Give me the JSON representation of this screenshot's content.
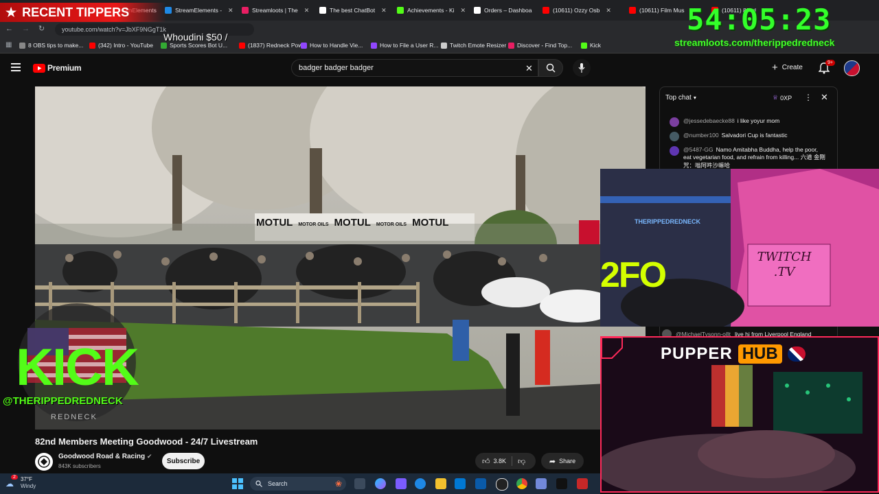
{
  "browser": {
    "tabs": [
      {
        "title": "StreamElements",
        "color": "#444"
      },
      {
        "title": "StreamElements -",
        "color": "#1e88e5"
      },
      {
        "title": "Streamloots | The",
        "color": "#e91e63"
      },
      {
        "title": "The best ChatBot",
        "color": "#fff"
      },
      {
        "title": "Achievements - Ki",
        "color": "#53fc18"
      },
      {
        "title": "Orders – Dashboa",
        "color": "#fff"
      },
      {
        "title": "(10611) Ozzy Osb",
        "color": "#ff0000"
      },
      {
        "title": "(10611) Film Mus",
        "color": "#ff0000"
      },
      {
        "title": "(10611) 82nd",
        "color": "#ff0000"
      }
    ],
    "url": "youtube.com/watch?v=JbXF9NGgT1k",
    "bookmarks": [
      {
        "label": "8 OBS tips to make...",
        "color": "#888"
      },
      {
        "label": "(342) Intro - YouTube",
        "color": "#ff0000"
      },
      {
        "label": "Sports Scores Bot U...",
        "color": "#3a3"
      },
      {
        "label": "(1837) Redneck Pow...",
        "color": "#ff0000"
      },
      {
        "label": "How to Handle Vie...",
        "color": "#9146ff"
      },
      {
        "label": "How to File a User R...",
        "color": "#9146ff"
      },
      {
        "label": "Twitch Emote Resizer",
        "color": "#ccc"
      },
      {
        "label": "Discover - Find Top...",
        "color": "#e91e63"
      },
      {
        "label": "Kick",
        "color": "#53fc18"
      }
    ]
  },
  "youtube": {
    "logo_text": "Premium",
    "search_query": "badger badger badger",
    "create_label": "Create",
    "notif_count": "9+",
    "video_title": "82nd Members Meeting Goodwood - 24/7 Livestream",
    "channel_name": "Goodwood Road & Racing",
    "subscribers": "843K subscribers",
    "subscribe_label": "Subscribe",
    "likes": "3.8K",
    "share_label": "Share",
    "banner_texts": [
      "MOTUL",
      "MOTOR OILS",
      "MOTUL",
      "MOTOR OILS",
      "MOTUL"
    ]
  },
  "chat": {
    "header": "Top chat",
    "points": "0XP",
    "messages": [
      {
        "author": "@jessedebaecke88",
        "text": "i like yoyur mom",
        "color": "#7b3fa0"
      },
      {
        "author": "@number100",
        "text": "Salvadori Cup is fantastic",
        "color": "#455a64"
      },
      {
        "author": "@5487-GG",
        "text": "Namo Amitabha Buddha, help the poor, eat vegetarian food, and refrain from killing... 六道 金剛咒：嗡阿吽沙嘛哈",
        "color": "#5e35b1"
      },
      {
        "author": "@MichaelTysonn-o8t",
        "text": "live hi from Liverpool England",
        "color": "#555"
      }
    ]
  },
  "overlay": {
    "timer": "54:05:23",
    "streamloots_url": "streamloots.com/therippedredneck",
    "recent_tippers": "RECENT TIPPERS",
    "ticker": "Whoudini $50 /",
    "kick_text": "KICK",
    "kick_handle": "@THERIPPEDREDNECK",
    "kick_sub": "REDNECK",
    "pupper": "PUPPER",
    "hub": "HUB",
    "twitch_sign": "TWITCH .TV",
    "webcam_banner": "THERIPPEDREDNECK",
    "neon_text": "2FO"
  },
  "taskbar": {
    "weather_temp": "37°F",
    "weather_desc": "Windy",
    "weather_badge": "2",
    "search_label": "Search"
  }
}
